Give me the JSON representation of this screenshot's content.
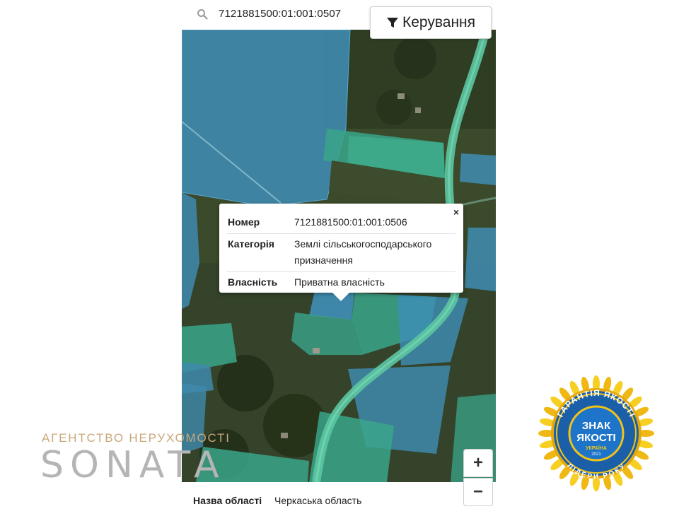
{
  "search": {
    "value": "7121881500:01:001:0507",
    "icon": "search-icon"
  },
  "manage_button": {
    "label": "Керування",
    "icon": "filter-icon"
  },
  "popup": {
    "rows": [
      {
        "key": "Номер",
        "value": "7121881500:01:001:0506"
      },
      {
        "key": "Категорія",
        "value": "Землі сільськогосподарського призначення"
      },
      {
        "key": "Власність",
        "value": "Приватна власність"
      }
    ],
    "close_label": "×"
  },
  "zoom": {
    "in_label": "+",
    "out_label": "−"
  },
  "bottom_info": {
    "key": "Назва області",
    "value": "Черкаська область"
  },
  "watermark": {
    "tagline": "АГЕНТСТВО НЕРУХОМОСТІ",
    "name": "SONATA"
  },
  "badge": {
    "arc_top": "ГАРАНТІЯ ЯКОСТІ",
    "center_line1": "ЗНАК",
    "center_line2": "ЯКОСТІ",
    "country": "УКРАЇНА",
    "year": "2021",
    "arc_bottom": "ЛІДЕРИ РОКУ"
  },
  "colors": {
    "parcel_blue": "#3f8fb8",
    "parcel_green": "#3aa88a",
    "road": "#5bc4a0",
    "badge_gold": "#f2c417",
    "badge_blue": "#1b66b3"
  }
}
